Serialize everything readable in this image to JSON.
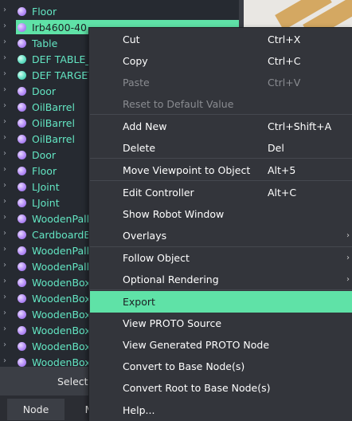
{
  "tree": {
    "items": [
      {
        "label": "Floor",
        "color": "purple"
      },
      {
        "label": "Irb4600-40",
        "color": "purple",
        "selected": true
      },
      {
        "label": "Table",
        "color": "purple"
      },
      {
        "label": "DEF TABLE_VISUAL",
        "color": "teal"
      },
      {
        "label": "DEF TARGET",
        "color": "teal"
      },
      {
        "label": "Door",
        "color": "purple"
      },
      {
        "label": "OilBarrel",
        "color": "purple"
      },
      {
        "label": "OilBarrel",
        "color": "purple"
      },
      {
        "label": "OilBarrel",
        "color": "purple"
      },
      {
        "label": "Door",
        "color": "purple"
      },
      {
        "label": "Floor",
        "color": "purple"
      },
      {
        "label": "LJoint",
        "color": "purple"
      },
      {
        "label": "LJoint",
        "color": "purple"
      },
      {
        "label": "WoodenPallet",
        "color": "purple"
      },
      {
        "label": "CardboardBox",
        "color": "purple"
      },
      {
        "label": "WoodenPallet",
        "color": "purple"
      },
      {
        "label": "WoodenPallet",
        "color": "purple"
      },
      {
        "label": "WoodenBox",
        "color": "purple"
      },
      {
        "label": "WoodenBox",
        "color": "purple"
      },
      {
        "label": "WoodenBox",
        "color": "purple"
      },
      {
        "label": "WoodenBox",
        "color": "purple"
      },
      {
        "label": "WoodenBox",
        "color": "purple"
      },
      {
        "label": "WoodenBox",
        "color": "purple"
      }
    ]
  },
  "bottom": {
    "selection_label": "Selection",
    "tabs": [
      "Node",
      "M"
    ]
  },
  "menu": {
    "items": [
      {
        "label": "Cut",
        "shortcut": "Ctrl+X"
      },
      {
        "label": "Copy",
        "shortcut": "Ctrl+C"
      },
      {
        "label": "Paste",
        "shortcut": "Ctrl+V",
        "disabled": true
      },
      {
        "label": "Reset to Default Value",
        "shortcut": "",
        "disabled": true
      },
      {
        "label": "Add New",
        "shortcut": "Ctrl+Shift+A"
      },
      {
        "label": "Delete",
        "shortcut": "Del"
      },
      {
        "label": "Move Viewpoint to Object",
        "shortcut": "Alt+5"
      },
      {
        "label": "Edit Controller",
        "shortcut": "Alt+C"
      },
      {
        "label": "Show Robot Window",
        "shortcut": ""
      },
      {
        "label": "Overlays",
        "shortcut": "",
        "submenu": true
      },
      {
        "label": "Follow Object",
        "shortcut": "",
        "submenu": true
      },
      {
        "label": "Optional Rendering",
        "shortcut": "",
        "submenu": true
      },
      {
        "label": "Export",
        "shortcut": "",
        "highlighted": true
      },
      {
        "label": "View PROTO Source",
        "shortcut": ""
      },
      {
        "label": "View Generated PROTO Node",
        "shortcut": ""
      },
      {
        "label": "Convert to Base Node(s)",
        "shortcut": ""
      },
      {
        "label": "Convert Root to Base Node(s)",
        "shortcut": ""
      },
      {
        "label": "Help...",
        "shortcut": ""
      }
    ]
  },
  "colors": {
    "accent": "#5fe2a7",
    "node_purple": "#b48cf7",
    "node_teal": "#63dfc4",
    "tree_label": "#63e6c3"
  }
}
